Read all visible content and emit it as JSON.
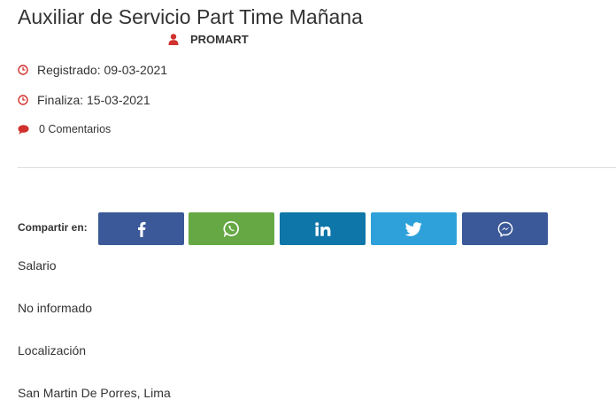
{
  "job": {
    "title": "Auxiliar de Servicio Part Time Mañana",
    "company": "PROMART",
    "registered": "Registrado: 09-03-2021",
    "ends": "Finaliza: 15-03-2021",
    "comments": "0 Comentarios"
  },
  "share": {
    "label": "Compartir en:",
    "buttons": [
      {
        "name": "facebook",
        "icon": "facebook-icon",
        "color": "#3b5998"
      },
      {
        "name": "whatsapp",
        "icon": "whatsapp-icon",
        "color": "#65a844"
      },
      {
        "name": "linkedin",
        "icon": "linkedin-icon",
        "color": "#0e76a8"
      },
      {
        "name": "twitter",
        "icon": "twitter-icon",
        "color": "#2ea1da"
      },
      {
        "name": "messenger",
        "icon": "messenger-icon",
        "color": "#3b5998"
      }
    ]
  },
  "details": {
    "salary_label": "Salario",
    "salary_value": "No informado",
    "location_label": "Localización",
    "location_value": "San Martin De Porres, Lima"
  },
  "colors": {
    "accent": "#d0312d",
    "divider": "#dddddd"
  }
}
